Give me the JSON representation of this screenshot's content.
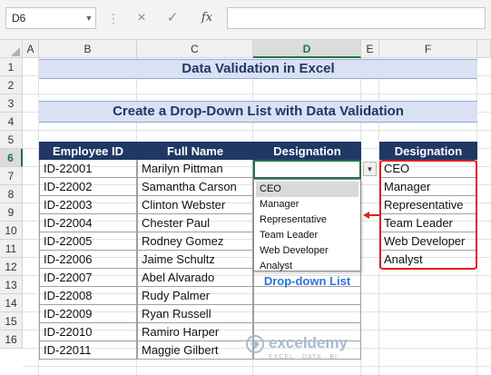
{
  "formula_bar": {
    "name_box": "D6",
    "cancel_icon": "×",
    "enter_icon": "✓",
    "fx_label": "fx",
    "formula_value": ""
  },
  "columns": [
    "A",
    "B",
    "C",
    "D",
    "E",
    "F"
  ],
  "rows": [
    "1",
    "2",
    "3",
    "4",
    "5",
    "6",
    "7",
    "8",
    "9",
    "10",
    "11",
    "12",
    "13",
    "14",
    "15",
    "16"
  ],
  "title": "Data Validation in Excel",
  "subtitle": "Create a Drop-Down List with Data Validation",
  "table": {
    "headers": [
      "Employee ID",
      "Full Name",
      "Designation"
    ],
    "employee_ids": [
      "ID-22001",
      "ID-22002",
      "ID-22003",
      "ID-22004",
      "ID-22005",
      "ID-22006",
      "ID-22007",
      "ID-22008",
      "ID-22009",
      "ID-22010",
      "ID-22011"
    ],
    "full_names": [
      "Marilyn Pittman",
      "Samantha Carson",
      "Clinton Webster",
      "Chester Paul",
      "Rodney Gomez",
      "Jaime Schultz",
      "Abel Alvarado",
      "Rudy Palmer",
      "Ryan Russell",
      "Ramiro Harper",
      "Maggie Gilbert"
    ]
  },
  "dropdown": {
    "options": [
      "CEO",
      "Manager",
      "Representative",
      "Team Leader",
      "Web Developer",
      "Analyst"
    ],
    "highlighted": "CEO",
    "caption": "Drop-down List"
  },
  "source_list": {
    "header": "Designation",
    "items": [
      "CEO",
      "Manager",
      "Representative",
      "Team Leader",
      "Web Developer",
      "Analyst"
    ]
  },
  "watermark": {
    "brand": "exceldemy",
    "tagline": "EXCEL · DATA · BI"
  },
  "colors": {
    "header_fill": "#1f3864",
    "banner_fill": "#d9e1f2",
    "highlight_red": "#e02020",
    "caption_blue": "#2e75d8",
    "selection_green": "#217346"
  }
}
